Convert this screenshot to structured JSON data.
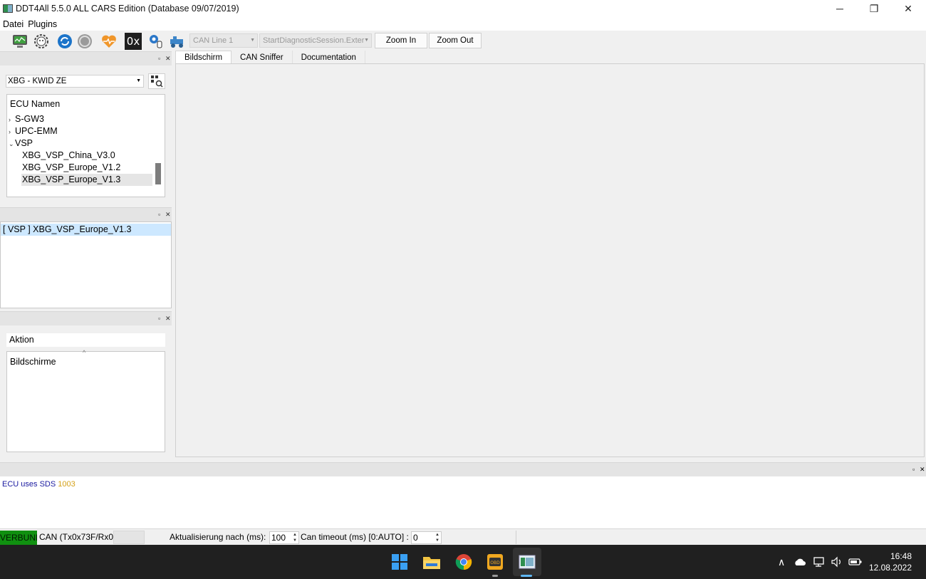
{
  "window": {
    "title": "DDT4All 5.5.0 ALL CARS Edition (Database 09/07/2019)",
    "minimize_glyph": "─",
    "restore_glyph": "❐",
    "close_glyph": "✕"
  },
  "menu": [
    "Datei",
    "Plugins"
  ],
  "toolbar": {
    "icons": [
      "monitor-icon",
      "gear-face-icon",
      "refresh-icon",
      "disabled-refresh-icon",
      "heart-icon",
      "hex-0x-icon",
      "hand-gear-icon",
      "tractor-icon"
    ],
    "hex_label": "0x",
    "can_line": "CAN Line 1",
    "session": "StartDiagnosticSession.Exter",
    "zoom_in": "Zoom In",
    "zoom_out": "Zoom Out"
  },
  "vehicle_select": {
    "value": "XBG - KWID ZE"
  },
  "ecu_tree": {
    "header": "ECU Namen",
    "items": [
      {
        "label": "S-GW3",
        "expanded": false
      },
      {
        "label": "UPC-EMM",
        "expanded": false
      },
      {
        "label": "VSP",
        "expanded": true
      },
      {
        "label": "XBG_VSP_China_V3.0"
      },
      {
        "label": "XBG_VSP_Europe_V1.2"
      },
      {
        "label": "XBG_VSP_Europe_V1.3",
        "selected": true
      }
    ]
  },
  "selected_ecu": "[ VSP ] XBG_VSP_Europe_V1.3",
  "action_panel": {
    "header": "Aktion",
    "item": "Bildschirme"
  },
  "tabs": [
    "Bildschirm",
    "CAN Sniffer",
    "Documentation"
  ],
  "log": {
    "prefix": "ECU uses SDS",
    "value": "1003",
    "prefix_color": "#1a1aa0",
    "value_color": "#d4a017"
  },
  "statusbar": {
    "badge": "VERBUNDEN",
    "can": "CAN (Tx0x73F/Rx0",
    "update_label": "Aktualisierung nach (ms):",
    "update_value": "100",
    "timeout_label": "Can timeout (ms) [0:AUTO] :",
    "timeout_value": "0"
  },
  "taskbar": {
    "apps": [
      "windows-start-icon",
      "file-explorer-icon",
      "chrome-icon",
      "obd-app-icon",
      "ddt4all-app-icon"
    ],
    "time": "16:48",
    "date": "12.08.2022"
  },
  "colors": {
    "accent_blue": "#cde8ff",
    "connected_green": "#109010"
  }
}
